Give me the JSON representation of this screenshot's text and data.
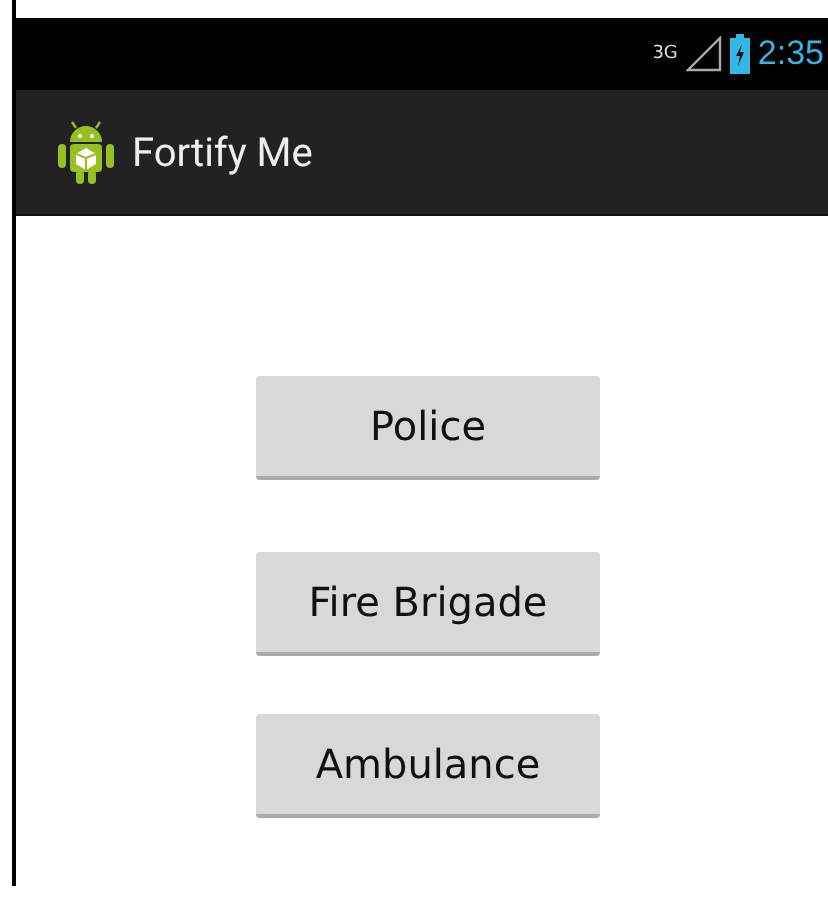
{
  "status_bar": {
    "network": "3G",
    "time": "2:35"
  },
  "action_bar": {
    "title": "Fortify Me"
  },
  "buttons": [
    "Police",
    "Fire Brigade",
    "Ambulance"
  ]
}
